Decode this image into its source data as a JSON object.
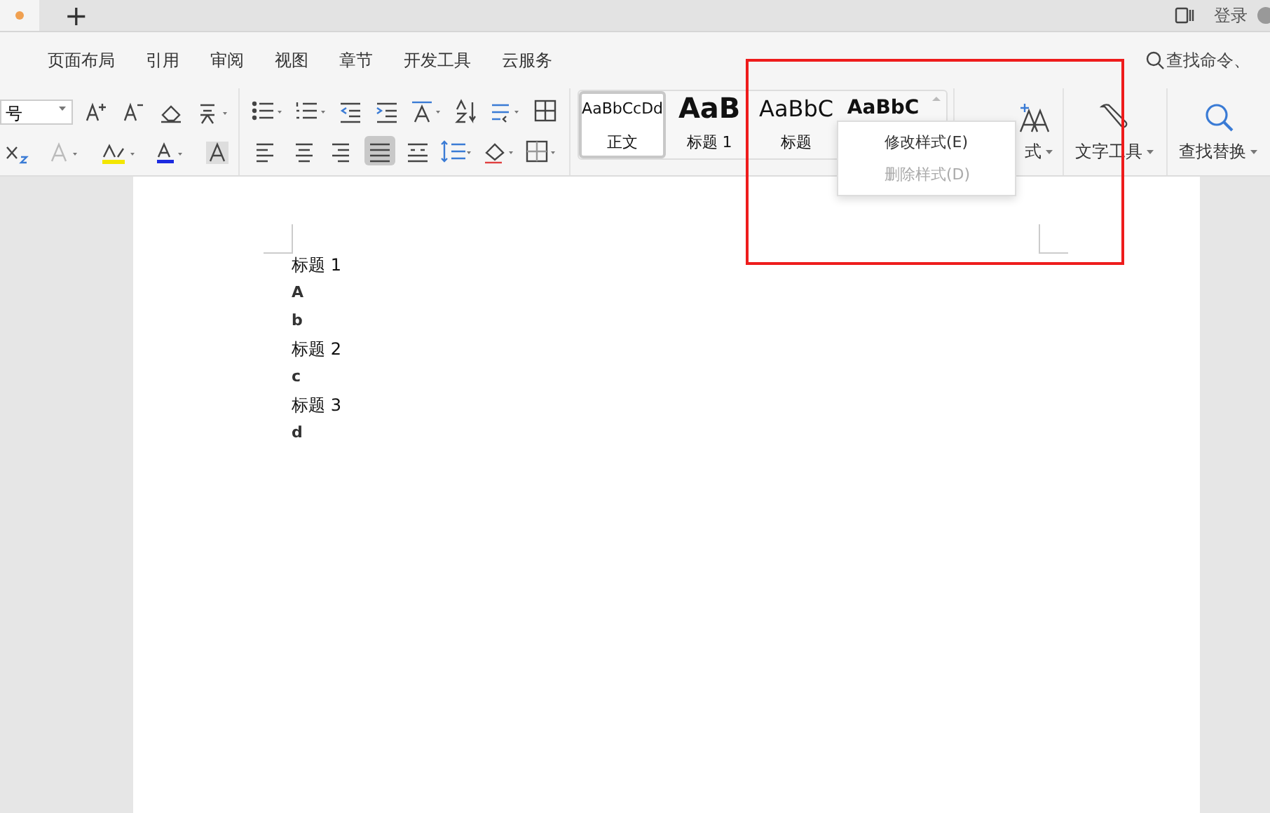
{
  "tab_bar": {
    "new_tab": "+",
    "login": "登录"
  },
  "menu": [
    "页面布局",
    "引用",
    "审阅",
    "视图",
    "章节",
    "开发工具",
    "云服务"
  ],
  "command_search": {
    "placeholder": "查找命令、"
  },
  "toolbar": {
    "font_size": "号",
    "alignment": [
      {
        "selected": false
      },
      {
        "selected": false
      },
      {
        "selected": false
      },
      {
        "selected": true
      },
      {
        "selected": false
      }
    ],
    "styles": [
      {
        "kind": "normal",
        "sample": "AaBbCcDd",
        "label": "正文",
        "selected": true
      },
      {
        "kind": "heading1",
        "sample": "AaB",
        "label": "标题 1",
        "selected": false
      },
      {
        "kind": "heading2",
        "sample": "AaBbC",
        "label": "标题",
        "selected": false
      },
      {
        "kind": "heading3",
        "sample": "AaBbC",
        "selected": false
      }
    ],
    "new_style": "式",
    "text_tools": "文字工具",
    "find_replace": "查找替换"
  },
  "context_menu": [
    {
      "label": "修改样式(E)",
      "disabled": false
    },
    {
      "label": "删除样式(D)",
      "disabled": true
    }
  ],
  "document": {
    "lines": [
      {
        "kind": "heading",
        "text": "标题 1"
      },
      {
        "kind": "body",
        "text": "A"
      },
      {
        "kind": "body",
        "text": "b"
      },
      {
        "kind": "heading",
        "text": "标题 2"
      },
      {
        "kind": "body",
        "text": "c"
      },
      {
        "kind": "heading",
        "text": "标题 3"
      },
      {
        "kind": "body",
        "text": "d"
      }
    ]
  }
}
